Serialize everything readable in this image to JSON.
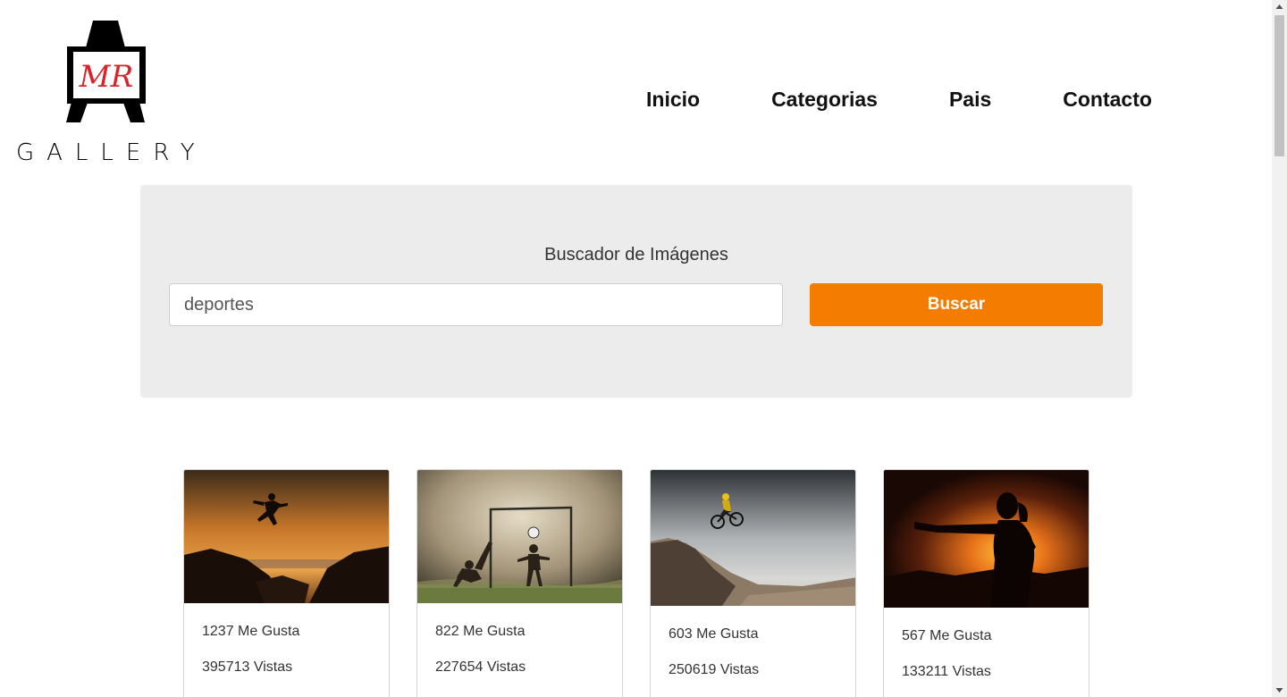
{
  "brand": {
    "monogram": "MR",
    "wordmark": "GALLERY"
  },
  "nav": {
    "items": [
      {
        "label": "Inicio"
      },
      {
        "label": "Categorias"
      },
      {
        "label": "Pais"
      },
      {
        "label": "Contacto"
      }
    ]
  },
  "search": {
    "title": "Buscador de Imágenes",
    "value": "deportes",
    "button_label": "Buscar"
  },
  "colors": {
    "accent": "#f47c00",
    "panel_bg": "#ececec"
  },
  "results": [
    {
      "likes": "1237 Me Gusta",
      "views": "395713 Vistas",
      "image": "silhouette-jumping-sunset"
    },
    {
      "likes": "822 Me Gusta",
      "views": "227654 Vistas",
      "image": "kids-playing-soccer"
    },
    {
      "likes": "603 Me Gusta",
      "views": "250619 Vistas",
      "image": "mountain-bike-jump"
    },
    {
      "likes": "567 Me Gusta",
      "views": "133211 Vistas",
      "image": "woman-boxing-sunset"
    }
  ]
}
